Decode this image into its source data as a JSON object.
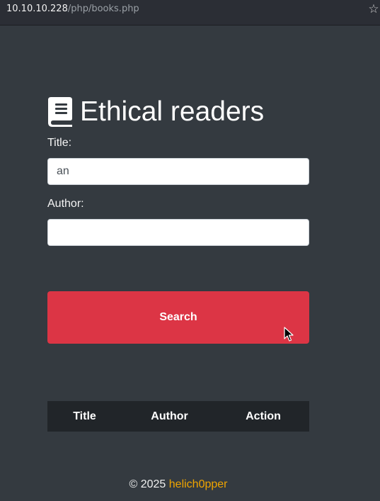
{
  "browser": {
    "url_host": "10.10.10.228",
    "url_path": "/php/books.php",
    "bookmark_icon": "star-icon"
  },
  "header": {
    "icon": "book-icon",
    "title": "Ethical readers"
  },
  "form": {
    "title_label": "Title:",
    "title_value": "an",
    "author_label": "Author:",
    "author_value": "",
    "search_label": "Search"
  },
  "results": {
    "columns": [
      "Title",
      "Author",
      "Action"
    ],
    "rows": []
  },
  "footer": {
    "copyright": "© 2025",
    "author": "helich0pper"
  },
  "colors": {
    "background": "#343a40",
    "accent": "#dc3545",
    "table_header": "#212529",
    "link": "#f0a500"
  }
}
